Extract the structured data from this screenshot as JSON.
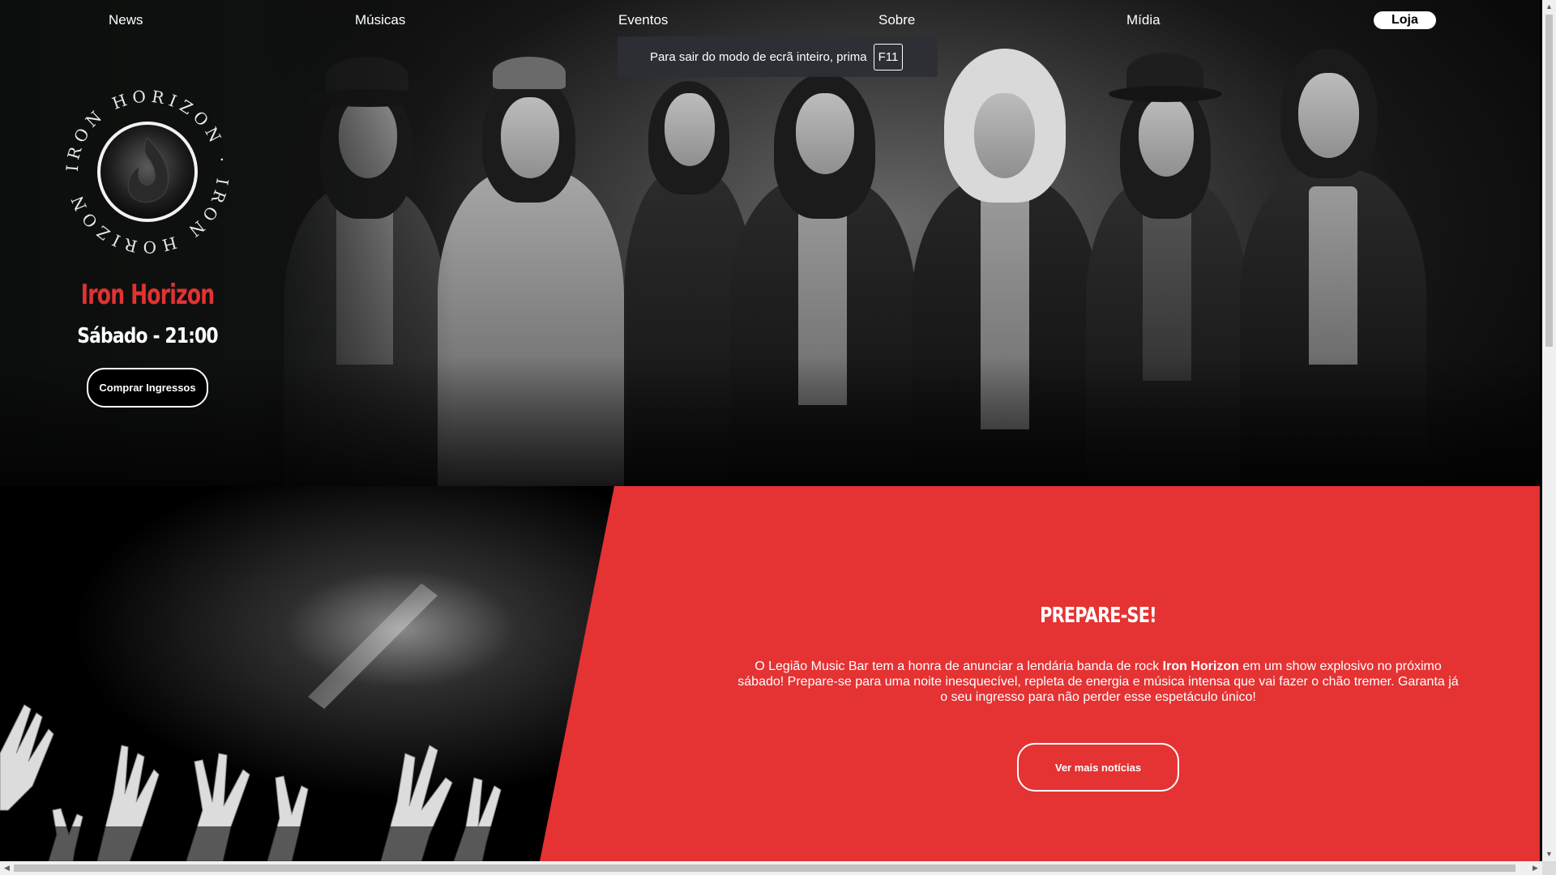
{
  "nav": {
    "items": [
      "News",
      "Músicas",
      "Eventos",
      "Sobre",
      "Mídia"
    ],
    "shop_label": "Loja"
  },
  "fullscreen_notice": {
    "text": "Para sair do modo de ecrã inteiro, prima",
    "key": "F11"
  },
  "logo": {
    "ring_text": "IRON HORIZON · IRON HORIZON",
    "icon": "flame-icon"
  },
  "hero": {
    "band_name": "Iron Horizon",
    "show_time": "Sábado - 21:00",
    "tickets_button": "Comprar Ingressos"
  },
  "news": {
    "title": "PREPARE-SE!",
    "text_before": "O Legião Music Bar tem a honra de anunciar a lendária banda de rock ",
    "text_bold": "Iron Horizon",
    "text_after": " em um show explosivo no próximo sábado! Prepare-se para uma noite inesquecível, repleta de energia e música intensa que vai fazer o chão tremer. Garanta já o seu ingresso para não perder esse espetáculo único!",
    "more_button": "Ver mais notícias"
  },
  "colors": {
    "accent_red": "#e53233",
    "title_red": "#e23232",
    "nav_text": "#ffffff"
  }
}
